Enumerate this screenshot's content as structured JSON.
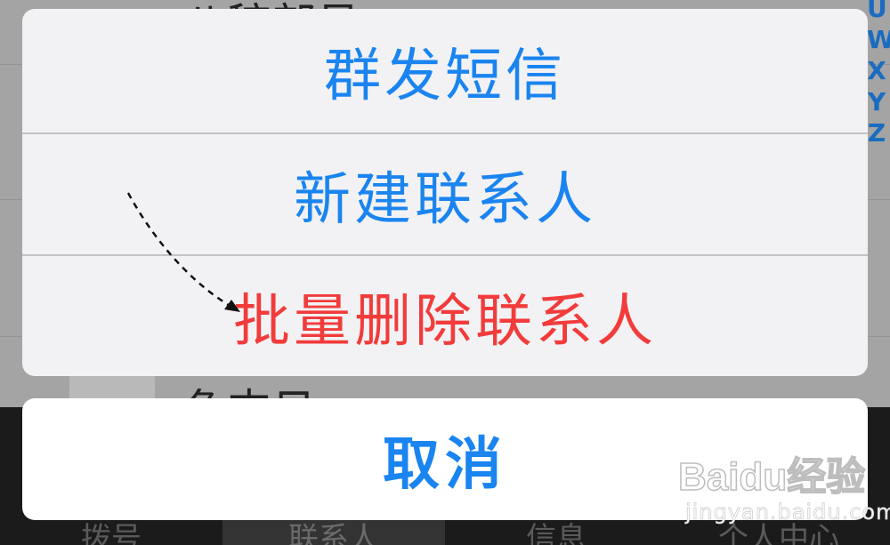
{
  "background": {
    "contacts": [
      {
        "name": "八稼部号"
      },
      {
        "name": ""
      },
      {
        "name": ""
      },
      {
        "name": "负支日"
      }
    ],
    "index_letters": [
      "U",
      "W",
      "X",
      "Y",
      "Z"
    ],
    "tabbar": [
      {
        "label": "拨号",
        "active": false
      },
      {
        "label": "联系人",
        "active": true
      },
      {
        "label": "信息",
        "active": false
      },
      {
        "label": "个人中心",
        "active": false
      }
    ]
  },
  "action_sheet": {
    "items": [
      {
        "label": "群发短信",
        "style": "default"
      },
      {
        "label": "新建联系人",
        "style": "default"
      },
      {
        "label": "批量删除联系人",
        "style": "destructive"
      }
    ],
    "cancel_label": "取消"
  },
  "colors": {
    "action_blue": "#1a84f0",
    "destructive_red": "#f23b3b",
    "sheet_bg": "#f2f2f4",
    "overlay_dim": "#a4a4a4"
  },
  "annotation": {
    "icon": "dashed-arrow-icon"
  },
  "watermark": {
    "logo_text": "Baidu经验",
    "sub_text": "jingyan.baidu.com"
  }
}
